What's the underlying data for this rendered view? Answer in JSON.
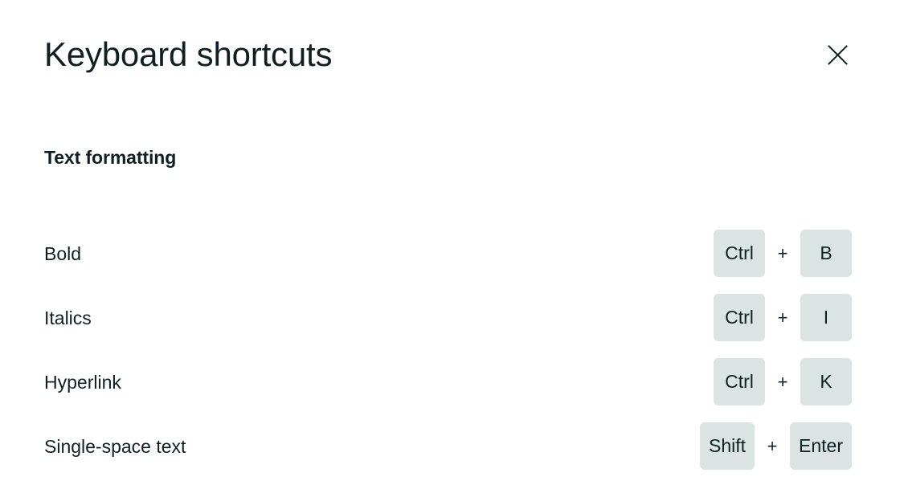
{
  "dialog": {
    "title": "Keyboard shortcuts",
    "close_label": "Close",
    "close_icon": "close-icon"
  },
  "section": {
    "heading": "Text formatting"
  },
  "colors": {
    "text": "#0f2020",
    "key_chip_background": "#dce3e3",
    "dialog_background": "#ffffff",
    "edge_strip": "#8b8b8b"
  },
  "shortcuts": [
    {
      "label": "Bold",
      "keys": [
        "Ctrl",
        "B"
      ],
      "separator": "+"
    },
    {
      "label": "Italics",
      "keys": [
        "Ctrl",
        "I"
      ],
      "separator": "+"
    },
    {
      "label": "Hyperlink",
      "keys": [
        "Ctrl",
        "K"
      ],
      "separator": "+"
    },
    {
      "label": "Single-space text",
      "keys": [
        "Shift",
        "Enter"
      ],
      "separator": "+"
    }
  ]
}
